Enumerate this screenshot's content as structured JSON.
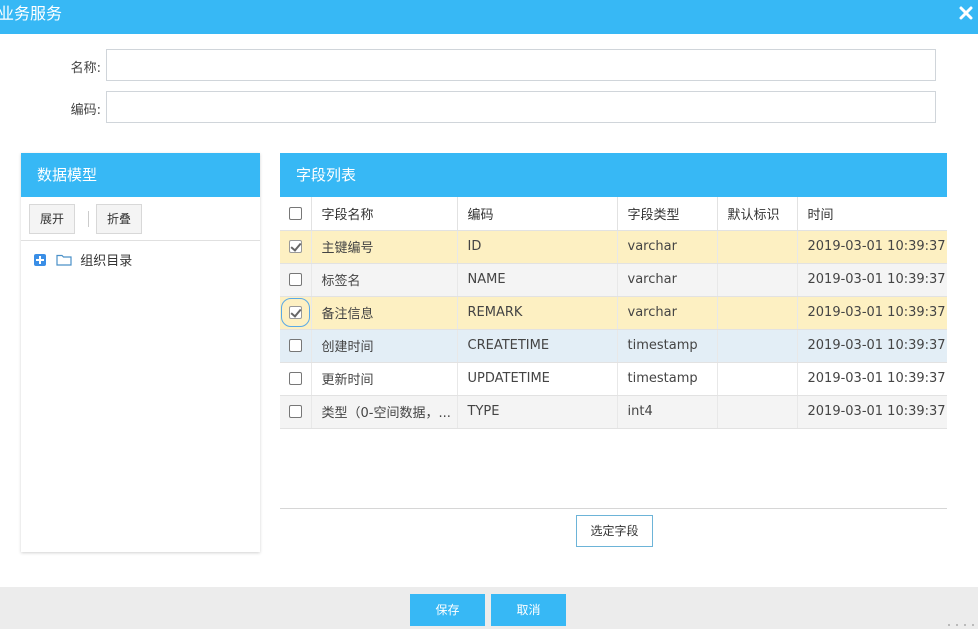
{
  "dialog": {
    "title": "业务服务"
  },
  "form": {
    "name_label": "名称:",
    "name_value": "",
    "code_label": "编码:",
    "code_value": ""
  },
  "left_panel": {
    "title": "数据模型",
    "expand_label": "展开",
    "collapse_label": "折叠",
    "tree": [
      {
        "label": "组织目录"
      }
    ]
  },
  "right_panel": {
    "title": "字段列表",
    "columns": [
      "字段名称",
      "编码",
      "字段类型",
      "默认标识",
      "时间"
    ],
    "rows": [
      {
        "checked": true,
        "name": "主键编号",
        "code": "ID",
        "type": "varchar",
        "default": "",
        "time": "2019-03-01 10:39:37"
      },
      {
        "checked": false,
        "name": "标签名",
        "code": "NAME",
        "type": "varchar",
        "default": "",
        "time": "2019-03-01 10:39:37"
      },
      {
        "checked": true,
        "name": "备注信息",
        "code": "REMARK",
        "type": "varchar",
        "default": "",
        "time": "2019-03-01 10:39:37"
      },
      {
        "checked": false,
        "name": "创建时间",
        "code": "CREATETIME",
        "type": "timestamp",
        "default": "",
        "time": "2019-03-01 10:39:37"
      },
      {
        "checked": false,
        "name": "更新时间",
        "code": "UPDATETIME",
        "type": "timestamp",
        "default": "",
        "time": "2019-03-01 10:39:37"
      },
      {
        "checked": false,
        "name": "类型（0-空间数据，...",
        "code": "TYPE",
        "type": "int4",
        "default": "",
        "time": "2019-03-01 10:39:37"
      }
    ],
    "pick_label": "选定字段"
  },
  "footer": {
    "save_label": "保存",
    "cancel_label": "取消"
  },
  "colors": {
    "accent": "#37b8f5",
    "selected_row": "#fdf0c2",
    "hover_row": "#e3eef6"
  },
  "icons": {
    "close": "close-icon",
    "expand_node": "plus-square-icon",
    "folder": "folder-icon"
  }
}
